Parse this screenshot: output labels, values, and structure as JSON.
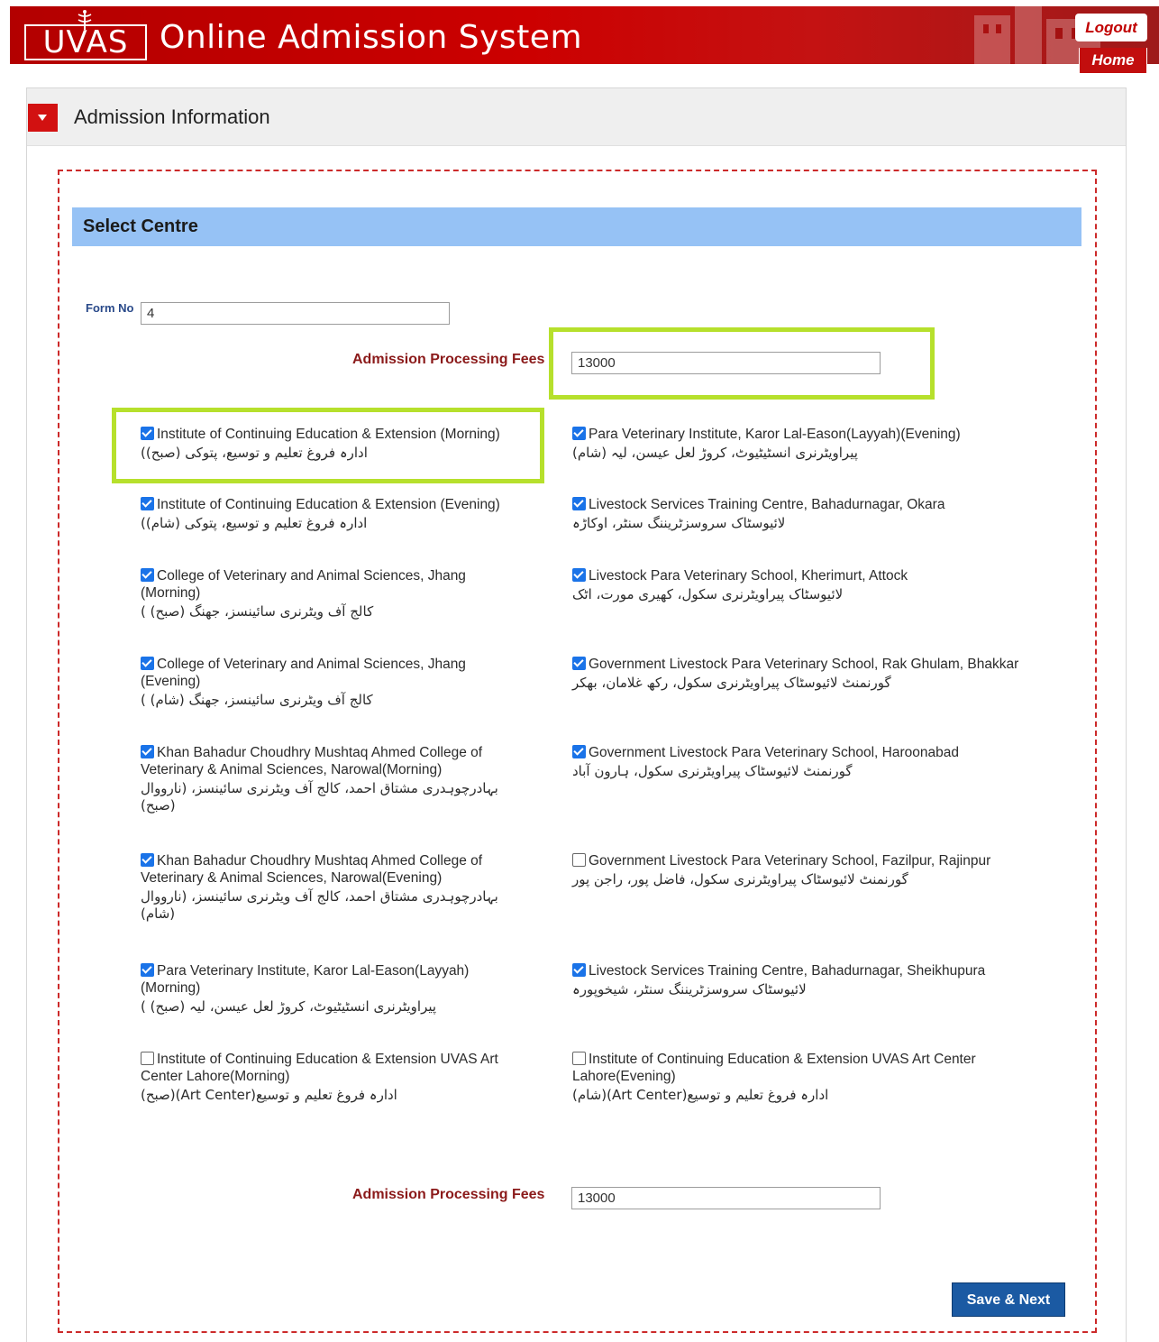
{
  "header": {
    "logo_text": "UVAS",
    "title": "Online Admission System",
    "logout_label": "Logout",
    "home_label": "Home",
    "brand_color": "#c00000"
  },
  "panel": {
    "title": "Admission Information",
    "section_title": "Select Centre"
  },
  "form": {
    "form_no_label": "Form No",
    "form_no_value": "4",
    "fee_label": "Admission Processing Fees",
    "fee_value": "13000",
    "fee_label_bottom": "Admission Processing Fees",
    "fee_value_bottom": "13000",
    "save_label": "Save & Next"
  },
  "centres": [
    {
      "en": "Institute of Continuing Education & Extension (Morning)",
      "ur": "ادارہ فروغ تعلیم و توسیع، پتوکی (صبح))",
      "checked": true
    },
    {
      "en": "Para Veterinary Institute, Karor Lal-Eason(Layyah)(Evening)",
      "ur": "پیراویٹرنری انسٹیٹیوٹ، کروڑ لعل عیسن، لیہ (شام)",
      "checked": true
    },
    {
      "en": "Institute of Continuing Education & Extension (Evening)",
      "ur": "ادارہ فروغ تعلیم و توسیع، پتوکی (شام))",
      "checked": true
    },
    {
      "en": "Livestock Services Training Centre, Bahadurnagar, Okara",
      "ur": "لائیوسٹاک سروسزٹریننگ سنٹر، اوکاڑہ",
      "checked": true
    },
    {
      "en": "College of Veterinary and Animal Sciences, Jhang (Morning)",
      "ur": "کالج آف ویٹرنری سائینسز، جھنگ (صبح) )",
      "checked": true
    },
    {
      "en": "Livestock Para Veterinary School, Kherimurt, Attock",
      "ur": "لائیوسٹاک پیراویٹرنری سکول، کھیری مورت، اٹک",
      "checked": true
    },
    {
      "en": "College of Veterinary and Animal Sciences, Jhang (Evening)",
      "ur": "کالج آف ویٹرنری سائینسز، جھنگ (شام) )",
      "checked": true
    },
    {
      "en": "Government Livestock Para Veterinary School, Rak Ghulam, Bhakkar",
      "ur": "گورنمنٹ لائیوسٹاک پیراویٹرنری سکول، رکھ غلامان، بھکر",
      "checked": true
    },
    {
      "en": "Khan Bahadur Choudhry Mushtaq Ahmed College of Veterinary & Animal Sciences, Narowal(Morning)",
      "ur": "بہادرچوہدری مشتاق احمد، کالج آف ویٹرنری سائینسز، (نارووال (صبح)",
      "checked": true
    },
    {
      "en": "Government Livestock Para Veterinary School,  Haroonabad",
      "ur": "گورنمنٹ لائیوسٹاک پیراویٹرنری سکول، ہارون آباد",
      "checked": true
    },
    {
      "en": "Khan Bahadur Choudhry Mushtaq Ahmed College of Veterinary & Animal Sciences, Narowal(Evening)",
      "ur": "بہادرچوہدری مشتاق احمد، کالج آف ویٹرنری سائینسز، (نارووال (شام)",
      "checked": true
    },
    {
      "en": "Government Livestock Para Veterinary School, Fazilpur, Rajinpur",
      "ur": "گورنمنٹ لائیوسٹاک پیراویٹرنری سکول، فاضل پور، راجن پور",
      "checked": false
    },
    {
      "en": "Para Veterinary Institute, Karor Lal-Eason(Layyah) (Morning)",
      "ur": "پیراویٹرنری انسٹیٹیوٹ، کروڑ لعل عیسن، لیہ (صبح) )",
      "checked": true
    },
    {
      "en": "Livestock Services Training Centre, Bahadurnagar, Sheikhupura",
      "ur": "لائیوسٹاک سروسزٹریننگ سنٹر، شیخوپورہ",
      "checked": true
    },
    {
      "en": "Institute of Continuing Education & Extension UVAS Art Center Lahore(Morning)",
      "ur": "ادارہ فروغ تعلیم و توسیع(Art Center)(صبح)",
      "checked": false
    },
    {
      "en": "Institute of Continuing Education & Extension UVAS Art Center Lahore(Evening)",
      "ur": "ادارہ فروغ تعلیم و توسیع(Art Center)(شام)",
      "checked": false
    }
  ]
}
